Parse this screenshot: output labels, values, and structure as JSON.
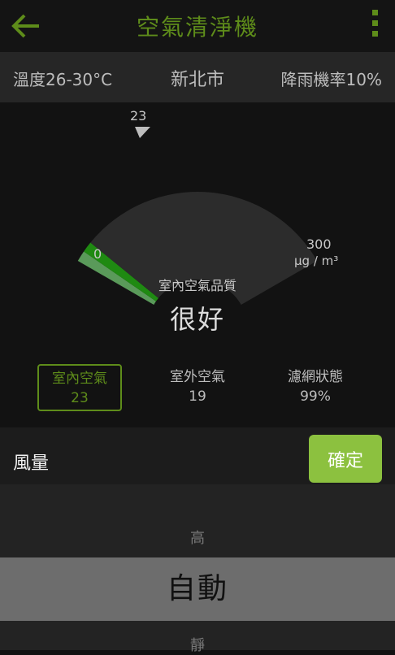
{
  "header": {
    "title": "空氣清淨機",
    "back_icon": "arrow-left-icon",
    "menu_icon": "more-vertical-icon",
    "accent": "#5e8c1a"
  },
  "info": {
    "temperature": "溫度26-30°C",
    "city": "新北市",
    "rain": "降雨機率10%"
  },
  "gauge": {
    "current": "23",
    "current_value": 23,
    "min_label": "0",
    "max_label": "300",
    "unit": "µg / m³",
    "min": 0,
    "max": 300,
    "quality_label": "室內空氣品質",
    "quality_value": "很好",
    "colors": {
      "low": "#5a9a5a",
      "mid": "#1f8a12",
      "rest": "#2c2c2c"
    }
  },
  "stats": [
    {
      "label": "室內空氣",
      "value": "23",
      "selected": true
    },
    {
      "label": "室外空氣",
      "value": "19",
      "selected": false
    },
    {
      "label": "濾網狀態",
      "value": "99%",
      "selected": false
    }
  ],
  "fan": {
    "label": "風量",
    "confirm": "確定",
    "options": {
      "above": "高",
      "selected": "自動",
      "below": "靜"
    },
    "confirm_color": "#8cc13f"
  }
}
